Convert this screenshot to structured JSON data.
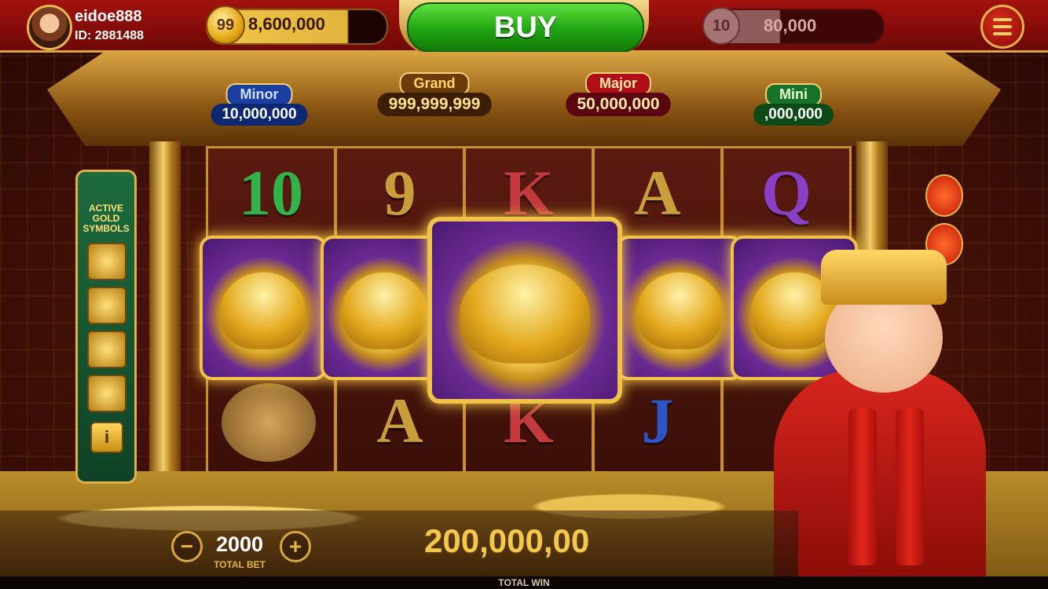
{
  "player": {
    "username": "eidoe888",
    "id_text": "ID: 2881488"
  },
  "coins": {
    "badge": "99",
    "balance": "8,600,000",
    "progress": 0.78
  },
  "buy": {
    "label": "BUY"
  },
  "level": {
    "badge": "10",
    "value": "80,000",
    "progress": 0.42
  },
  "jackpots": {
    "minor": {
      "label": "Minor",
      "value": "10,000,000"
    },
    "grand": {
      "label": "Grand",
      "value": "999,999,999"
    },
    "major": {
      "label": "Major",
      "value": "50,000,000"
    },
    "mini": {
      "label": "Mini",
      "value": ",000,000"
    }
  },
  "sidebar": {
    "title_line1": "ACTIVE",
    "title_line2": "GOLD",
    "title_line3": "SYMBOLS",
    "info_label": "i"
  },
  "reels": {
    "top_row": [
      "10",
      "9",
      "K",
      "A",
      "Q"
    ],
    "bottom_row": [
      "A",
      "K",
      "J"
    ],
    "middle_symbol": "golden-turtle"
  },
  "bet": {
    "value": "2000",
    "label": "TOTAL BET",
    "minus": "−",
    "plus": "+"
  },
  "win": {
    "value": "200,000,00",
    "label": "TOTAL WIN"
  },
  "colors": {
    "accent_gold": "#e0b14a",
    "topbar_red": "#a3120e",
    "buy_green": "#20a312"
  }
}
